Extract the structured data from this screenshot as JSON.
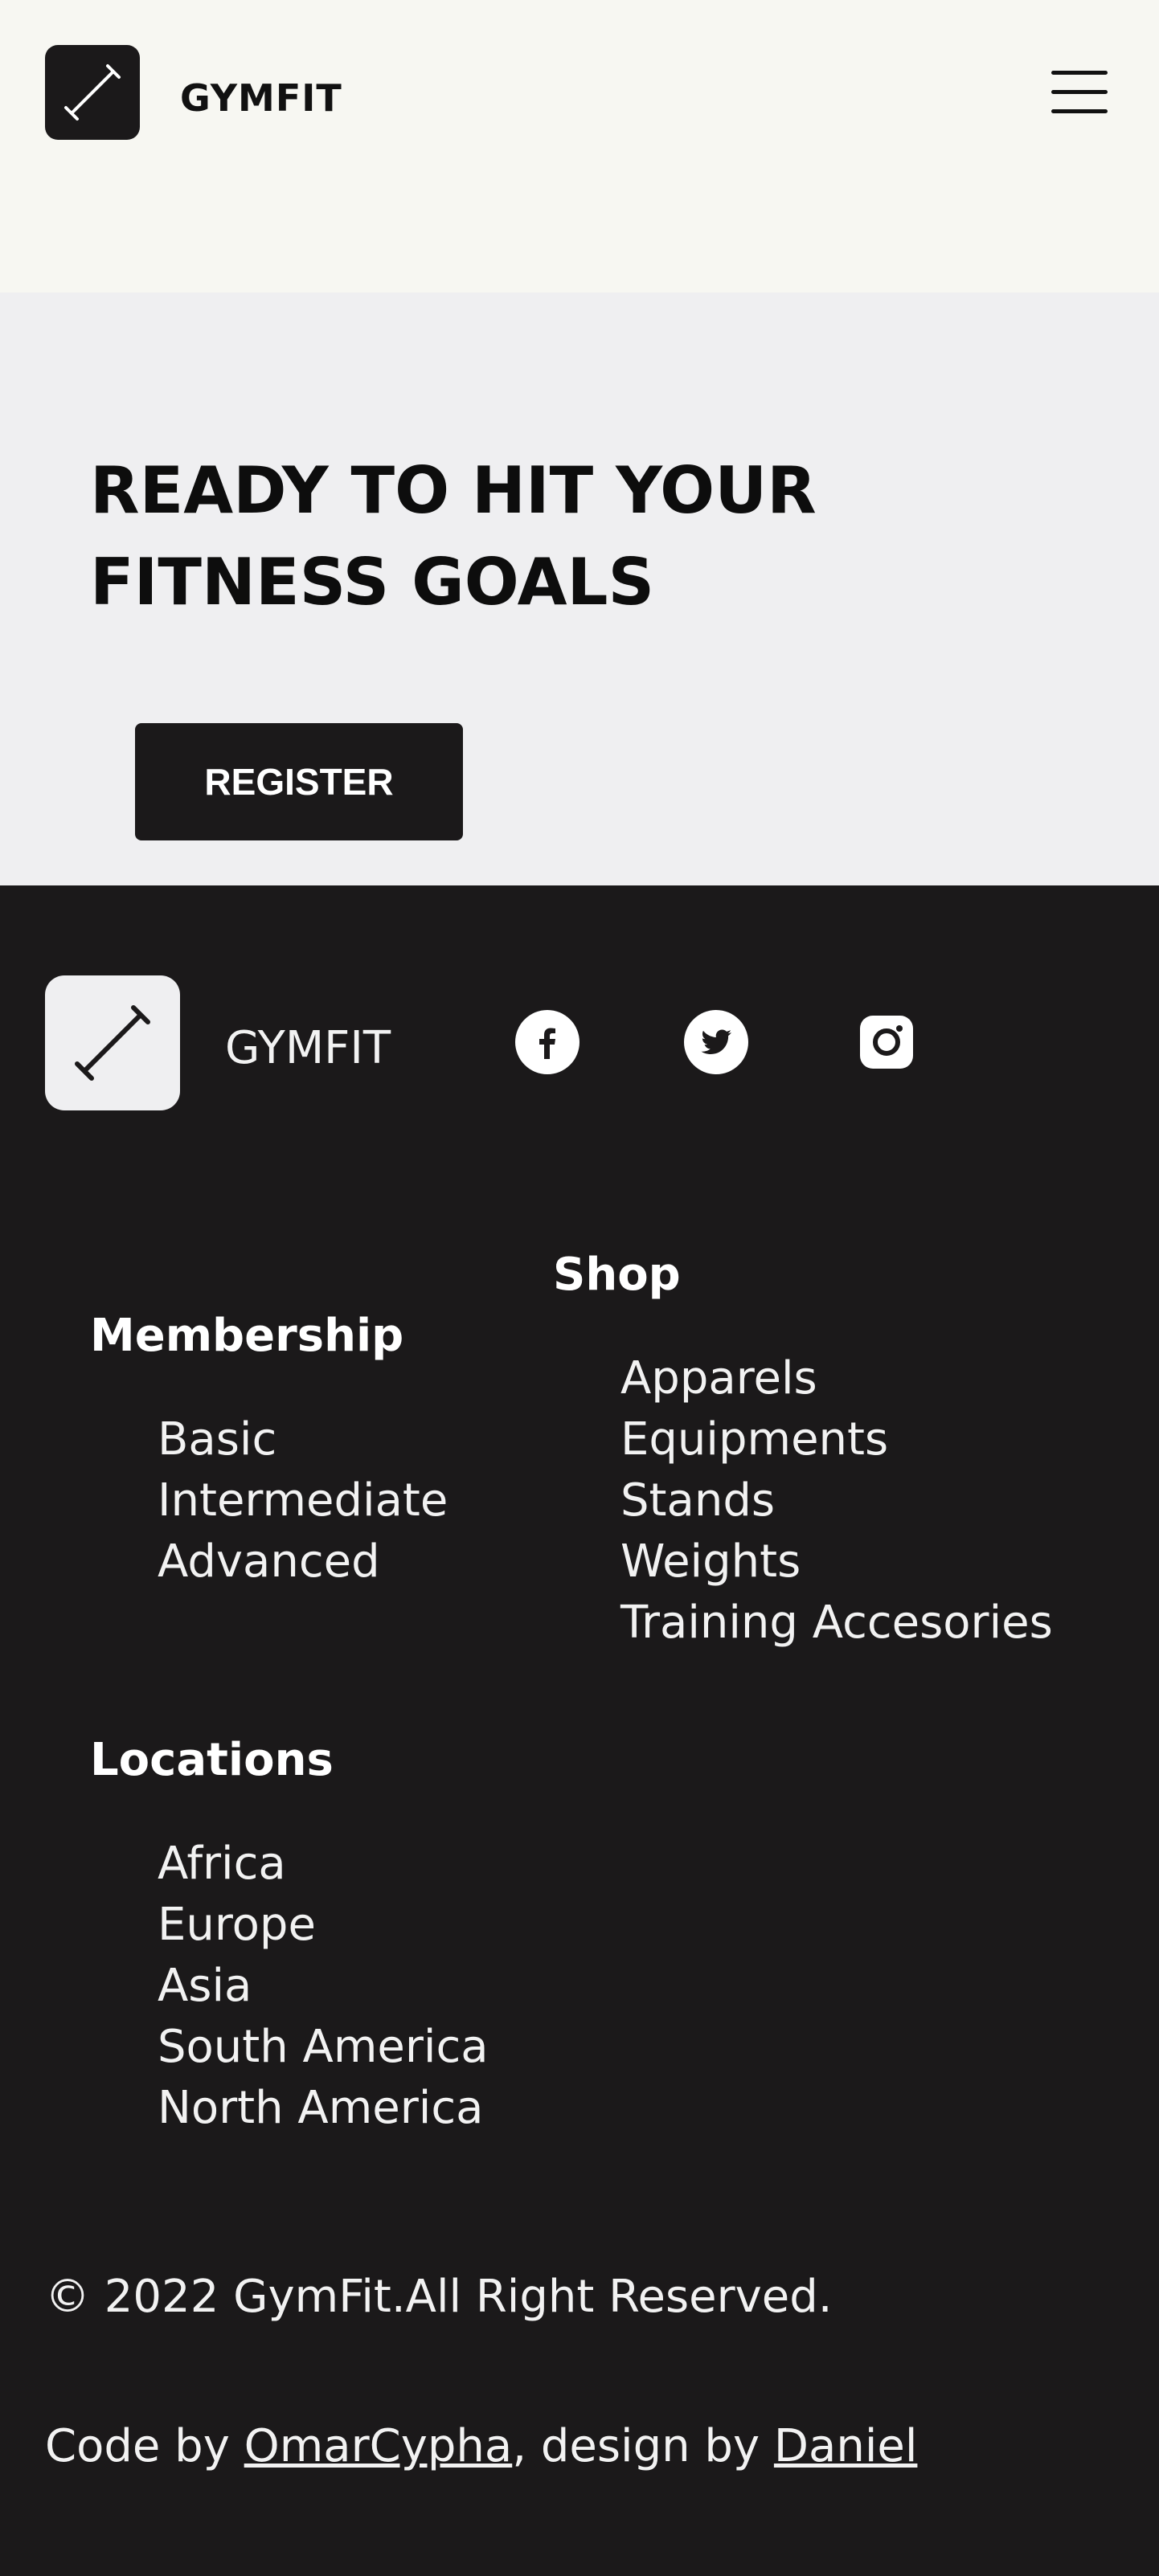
{
  "header": {
    "brand": "GYMFIT",
    "logo_icon": "dumbbell-icon",
    "menu_icon": "hamburger-menu-icon"
  },
  "hero": {
    "title": "READY TO HIT YOUR FITNESS GOALS",
    "register_label": "REGISTER"
  },
  "footer": {
    "brand": "GYMFIT",
    "logo_icon": "dumbbell-icon",
    "social": [
      "facebook-icon",
      "twitter-icon",
      "instagram-icon"
    ],
    "membership": {
      "title": "Membership",
      "items": [
        "Basic",
        "Intermediate",
        "Advanced"
      ]
    },
    "shop": {
      "title": "Shop",
      "items": [
        "Apparels",
        "Equipments",
        "Stands",
        "Weights",
        "Training Accesories"
      ]
    },
    "locations": {
      "title": "Locations",
      "items": [
        "Africa",
        "Europe",
        "Asia",
        "South America",
        "North America"
      ]
    },
    "copyright": "© 2022 GymFit.All Right Reserved.",
    "credits": {
      "prefix": "Code by ",
      "coder": "OmarCypha",
      "middle": ", design by ",
      "designer": "Daniel"
    }
  },
  "colors": {
    "dark": "#1b191a",
    "header_bg": "#f7f7f2",
    "hero_bg": "#efeff1",
    "text_light": "#f2f2f2"
  }
}
